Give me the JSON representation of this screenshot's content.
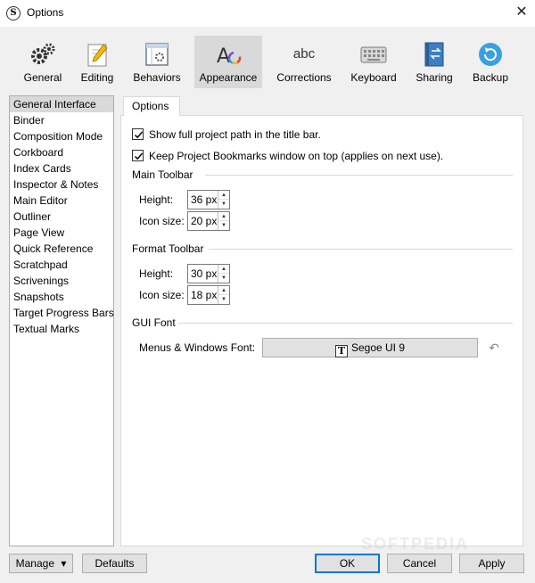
{
  "window": {
    "title": "Options",
    "app_icon": "scrivener-s-icon",
    "close_glyph": "✕"
  },
  "toolbar": {
    "items": [
      {
        "label": "General",
        "icon": "gears-icon"
      },
      {
        "label": "Editing",
        "icon": "pencil-page-icon"
      },
      {
        "label": "Behaviors",
        "icon": "window-gear-icon"
      },
      {
        "label": "Appearance",
        "icon": "letter-a-c-icon",
        "active": true
      },
      {
        "label": "Corrections",
        "icon": "abc-icon"
      },
      {
        "label": "Keyboard",
        "icon": "keyboard-icon"
      },
      {
        "label": "Sharing",
        "icon": "sharing-book-icon"
      },
      {
        "label": "Backup",
        "icon": "backup-circle-icon"
      }
    ],
    "corrections_icon_text": "abc",
    "appearance_icon_text": "A"
  },
  "sidebar": {
    "items": [
      {
        "label": "General Interface",
        "selected": true
      },
      {
        "label": "Binder"
      },
      {
        "label": "Composition Mode"
      },
      {
        "label": "Corkboard"
      },
      {
        "label": "Index Cards"
      },
      {
        "label": "Inspector & Notes"
      },
      {
        "label": "Main Editor"
      },
      {
        "label": "Outliner"
      },
      {
        "label": "Page View"
      },
      {
        "label": "Quick Reference"
      },
      {
        "label": "Scratchpad"
      },
      {
        "label": "Scrivenings"
      },
      {
        "label": "Snapshots"
      },
      {
        "label": "Target Progress Bars"
      },
      {
        "label": "Textual Marks"
      }
    ]
  },
  "panel": {
    "tab_label": "Options",
    "show_full_path": {
      "label": "Show full project path in the title bar.",
      "checked": true
    },
    "keep_bookmarks": {
      "label": "Keep Project Bookmarks window on top (applies on next use).",
      "checked": true
    },
    "main_toolbar": {
      "heading": "Main Toolbar",
      "height_label": "Height:",
      "height_value": "36 px",
      "icon_size_label": "Icon size:",
      "icon_size_value": "20 px"
    },
    "format_toolbar": {
      "heading": "Format Toolbar",
      "height_label": "Height:",
      "height_value": "30 px",
      "icon_size_label": "Icon size:",
      "icon_size_value": "18 px"
    },
    "gui_font": {
      "heading": "GUI Font",
      "menus_label": "Menus & Windows Font:",
      "font_value": "Segoe UI 9",
      "font_icon_glyph": "T",
      "reset_glyph": "↶"
    }
  },
  "footer": {
    "manage_label": "Manage",
    "manage_arrow": "▾",
    "defaults_label": "Defaults",
    "ok_label": "OK",
    "cancel_label": "Cancel",
    "apply_label": "Apply"
  },
  "watermark": "SOFTPEDIA",
  "colors": {
    "window_bg": "#f0f0f0",
    "selected_bg": "#d9d9d9",
    "default_button_border": "#0078d7",
    "backup_icon": "#3aa0e0",
    "appearance_gradient": [
      "#e8403a",
      "#f5b800",
      "#2aa4e0",
      "#7a4bd0"
    ]
  }
}
